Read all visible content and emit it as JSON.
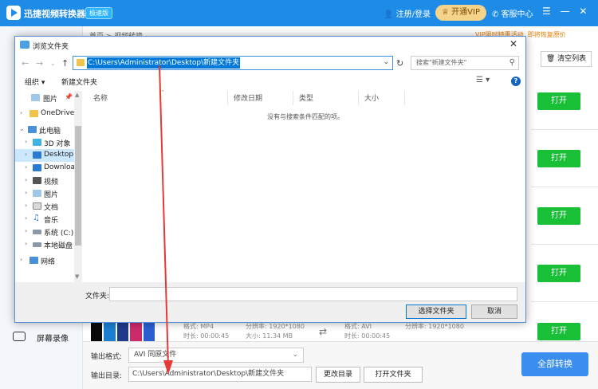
{
  "app": {
    "title": "迅捷视频转换器",
    "badge": "极速版",
    "user_login": "注册/登录",
    "vip_button": "开通VIP",
    "service": "客服中心",
    "breadcrumb": "首页 > 视频转换",
    "promo": "VIP限时特惠活动, 即将恢复原价",
    "clear_list": "清空列表",
    "open_label": "打开",
    "sidebar_screen_record": "屏幕录像"
  },
  "file_row": {
    "src_format": "格式: MP4",
    "src_duration": "时长: 00:00:45",
    "src_resolution": "分辨率: 1920*1080",
    "src_size": "大小: 11.34 MB",
    "dst_format": "格式: AVI",
    "dst_duration": "时长: 00:00:45",
    "dst_resolution": "分辨率: 1920*1080"
  },
  "bottom": {
    "output_format_label": "输出格式:",
    "output_format_value": "AVI  同原文件",
    "output_dir_label": "输出目录:",
    "output_dir_value": "C:\\Users\\Administrator\\Desktop\\新建文件夹",
    "change_dir": "更改目录",
    "open_folder": "打开文件夹",
    "convert_all": "全部转换"
  },
  "dialog": {
    "title": "浏览文件夹",
    "address": "C:\\Users\\Administrator\\Desktop\\新建文件夹",
    "search_placeholder": "搜索\"新建文件夹\"",
    "organize": "组织 ▾",
    "new_folder": "新建文件夹",
    "columns": [
      "名称",
      "修改日期",
      "类型",
      "大小"
    ],
    "empty_message": "没有与搜索条件匹配的项。",
    "filename_label": "文件夹:",
    "select_button": "选择文件夹",
    "cancel_button": "取消",
    "nav_items": [
      {
        "label": "图片",
        "icon": "pictures-icon",
        "pinned": true
      },
      {
        "label": "OneDrive",
        "icon": "onedrive-icon"
      },
      {
        "label": "此电脑",
        "icon": "computer-icon",
        "expanded": true
      },
      {
        "label": "3D 对象",
        "icon": "3d-objects-icon"
      },
      {
        "label": "Desktop",
        "icon": "desktop-icon",
        "selected": true
      },
      {
        "label": "Downloads",
        "icon": "downloads-icon"
      },
      {
        "label": "视频",
        "icon": "videos-icon"
      },
      {
        "label": "图片",
        "icon": "pictures-icon"
      },
      {
        "label": "文档",
        "icon": "documents-icon"
      },
      {
        "label": "音乐",
        "icon": "music-icon"
      },
      {
        "label": "系统 (C:)",
        "icon": "drive-c-icon"
      },
      {
        "label": "本地磁盘",
        "icon": "drive-icon"
      },
      {
        "label": "网络",
        "icon": "network-icon"
      }
    ]
  },
  "colors": {
    "header_blue": "#1e8ce6",
    "open_green": "#19c037",
    "convert_blue": "#3a8ef0",
    "selection_blue": "#0078d7",
    "annotation_red": "#e53935"
  }
}
